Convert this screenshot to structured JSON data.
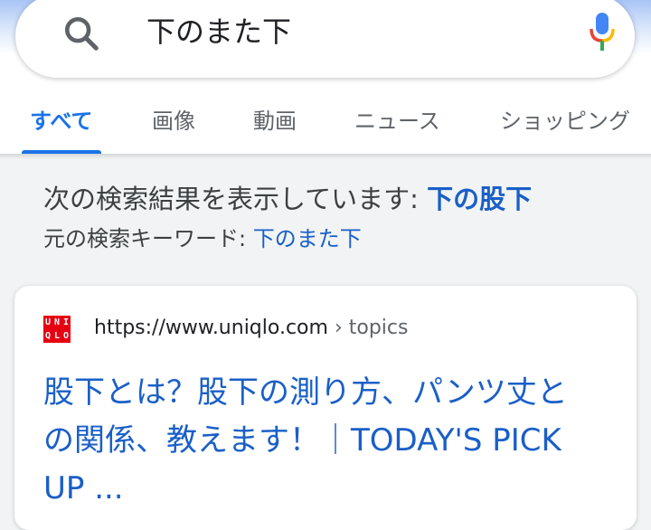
{
  "search": {
    "query": "下のまた下"
  },
  "tabs": [
    {
      "label": "すべて",
      "active": true
    },
    {
      "label": "画像",
      "active": false
    },
    {
      "label": "動画",
      "active": false
    },
    {
      "label": "ニュース",
      "active": false
    },
    {
      "label": "ショッピング",
      "active": false
    }
  ],
  "correction": {
    "showing_prefix": "次の検索結果を表示しています: ",
    "corrected_query": "下の股下",
    "original_prefix": "元の検索キーワード: ",
    "original_query": "下のまた下"
  },
  "result": {
    "favicon_letters": [
      "U",
      "N",
      "I",
      "Q",
      "L",
      "O"
    ],
    "url": "https://www.uniqlo.com",
    "breadcrumb": " › topics",
    "title": "股下とは？股下の測り方、パンツ丈との関係、教えます！｜TODAY'S PICK UP ..."
  },
  "colors": {
    "accent": "#1a73e8",
    "link": "#1a5fc8",
    "uniqlo_red": "#e60012"
  },
  "icons": {
    "search": "search-icon",
    "mic": "mic-icon"
  }
}
